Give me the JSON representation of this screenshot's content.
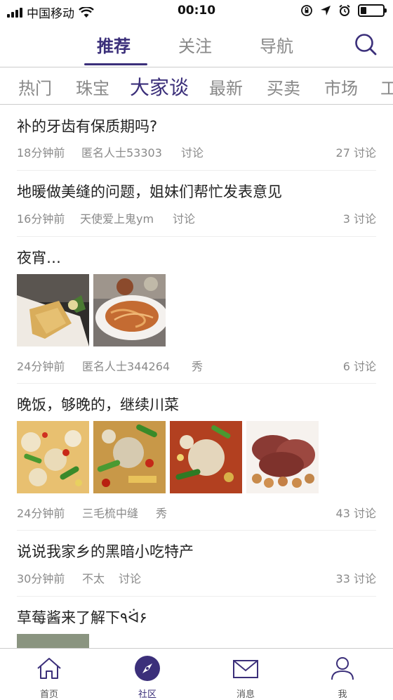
{
  "status_bar": {
    "carrier": "中国移动",
    "time": "00:10"
  },
  "top_tabs": [
    {
      "label": "推荐",
      "active": true
    },
    {
      "label": "关注",
      "active": false
    },
    {
      "label": "导航",
      "active": false
    }
  ],
  "category_tabs": [
    {
      "label": "热门"
    },
    {
      "label": "珠宝"
    },
    {
      "label": "大家谈",
      "active": true
    },
    {
      "label": "最新"
    },
    {
      "label": "买卖"
    },
    {
      "label": "市场"
    },
    {
      "label": "工"
    }
  ],
  "posts": [
    {
      "title": "补的牙齿有保质期吗?",
      "time": "18分钟前",
      "author": "匿名人士53303",
      "tag": "讨论",
      "count": "27 讨论"
    },
    {
      "title": "地暖做美缝的问题，姐妹们帮忙发表意见",
      "time": "16分钟前",
      "author": "天使爱上鬼ym",
      "tag": "讨论",
      "count": "3 讨论"
    },
    {
      "title": "夜宵…",
      "time": "24分钟前",
      "author": "匿名人士344264",
      "tag": "秀",
      "count": "6 讨论"
    },
    {
      "title": "晚饭，够晚的，继续川菜",
      "time": "24分钟前",
      "author": "三毛梳中缝",
      "tag": "秀",
      "count": "43 讨论"
    },
    {
      "title": "说说我家乡的黑暗小吃特产",
      "time": "30分钟前",
      "author": "不太",
      "tag": "讨论",
      "count": "33 讨论"
    },
    {
      "title": "草莓酱来了解下٩ᐛ۶"
    }
  ],
  "bottom_nav": [
    {
      "label": "首页",
      "icon": "home-icon"
    },
    {
      "label": "社区",
      "icon": "compass-icon",
      "active": true
    },
    {
      "label": "消息",
      "icon": "mail-icon"
    },
    {
      "label": "我",
      "icon": "user-icon"
    }
  ],
  "colors": {
    "accent": "#3b2f7a",
    "inactive_text": "#888888",
    "meta_text": "#8a8a8a"
  }
}
